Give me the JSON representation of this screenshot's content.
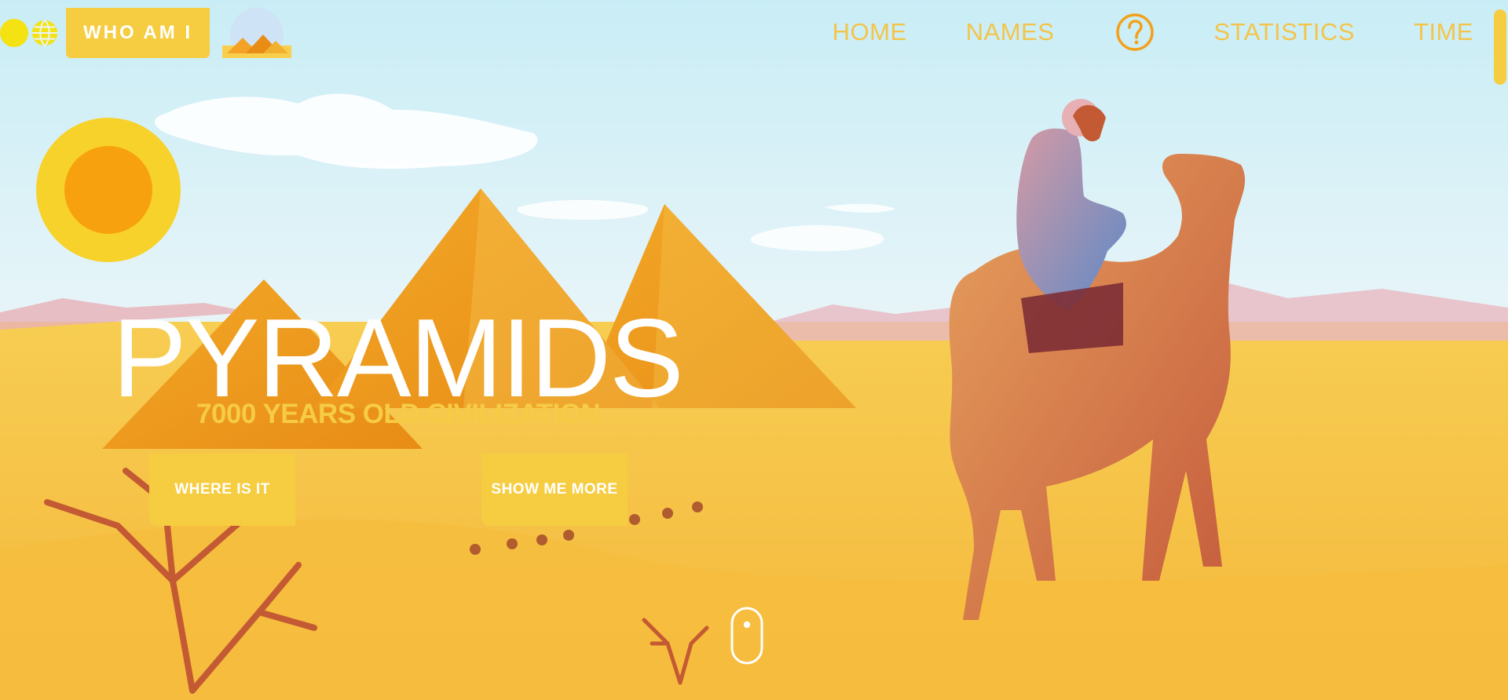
{
  "header": {
    "brand_label": "WHO AM I",
    "nav": [
      "HOME",
      "NAMES",
      "STATISTICS",
      "TIME"
    ],
    "icons": {
      "left": [
        "moon-icon",
        "globe-icon"
      ],
      "help": "help-icon"
    }
  },
  "hero": {
    "title": "PYRAMIDS",
    "subtitle": "7000 YEARS OLD CIVILIZATION",
    "buttons": {
      "where": "WHERE IS IT",
      "more": "SHOW ME MORE"
    },
    "scroll_hint_icon": "mouse-scroll-icon"
  },
  "colors": {
    "accent": "#f6cd41",
    "nav_text": "#f4c44a",
    "help_icon": "#f2a11c",
    "sky": "#cfeef6",
    "sand": "#f6c445"
  }
}
